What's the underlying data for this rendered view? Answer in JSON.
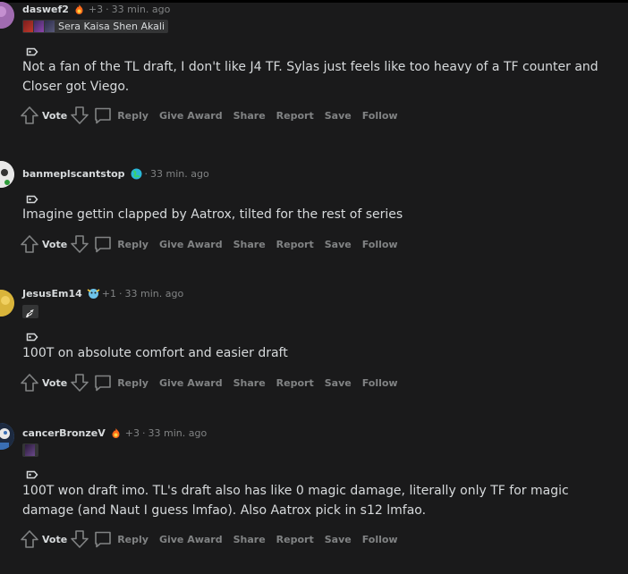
{
  "comments": [
    {
      "username": "daswef2",
      "award_count": "+3",
      "time": "33 min. ago",
      "flair_text": "Sera Kaisa Shen Akali",
      "body": "Not a fan of the TL draft, I don't like J4 TF. Sylas just feels like too heavy of a TF counter and Closer got Viego.",
      "avatar_color": "#a06bb0"
    },
    {
      "username": "banmeplscantstop",
      "award_count": "",
      "time": "33 min. ago",
      "flair_text": "",
      "body": "Imagine gettin clapped by Aatrox, tilted for the rest of series",
      "avatar_color": "#e8e8e8"
    },
    {
      "username": "JesusEm14",
      "award_count": "+1",
      "time": "33 min. ago",
      "flair_text": "",
      "body": "100T on absolute comfort and easier draft",
      "avatar_color": "#d9b43a"
    },
    {
      "username": "cancerBronzeV",
      "award_count": "+3",
      "time": "33 min. ago",
      "flair_text": "",
      "body": "100T won draft imo. TL's draft also has like 0 magic damage, literally only TF for magic damage (and Naut I guess lmfao). Also Aatrox pick in s12 lmfao.",
      "avatar_color": "#3a6fb5"
    }
  ],
  "actions": {
    "vote": "Vote",
    "reply": "Reply",
    "give_award": "Give Award",
    "share": "Share",
    "report": "Report",
    "save": "Save",
    "follow": "Follow"
  },
  "separator": "·",
  "colors": {
    "background": "#1a1a1b",
    "text": "#d7dadc",
    "muted": "#818384"
  }
}
